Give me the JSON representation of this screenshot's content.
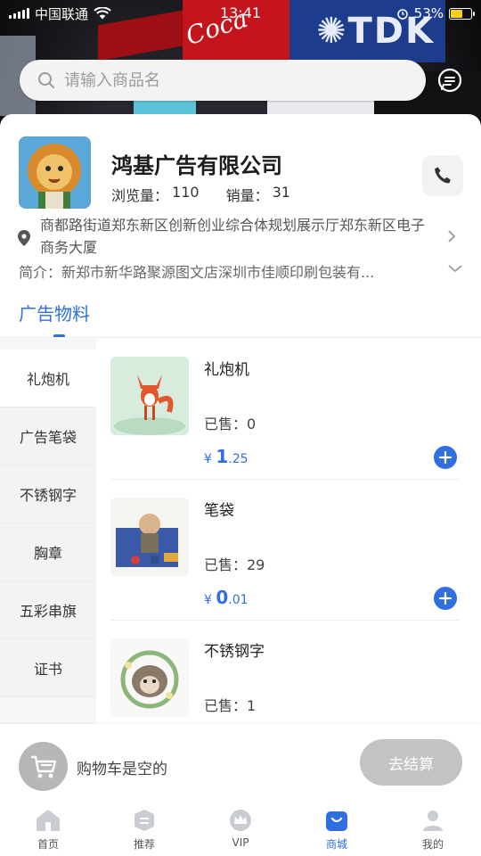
{
  "status_bar": {
    "carrier": "中国联通",
    "time": "13:41",
    "battery": "53%"
  },
  "search": {
    "placeholder": "请输入商品名"
  },
  "shop": {
    "name": "鸿基广告有限公司",
    "views_label": "浏览量：",
    "views": "110",
    "sales_label": "销量：",
    "sales": "31",
    "address": "商都路街道郑东新区创新创业综合体规划展示厅郑东新区电子商务大厦",
    "intro": "简介：新郑市新华路聚源图文店深圳市佳顺印刷包装有..."
  },
  "tab": {
    "label": "广告物料"
  },
  "categories": [
    {
      "label": "礼炮机"
    },
    {
      "label": "广告笔袋"
    },
    {
      "label": "不锈钢字"
    },
    {
      "label": "胸章"
    },
    {
      "label": "五彩串旗"
    },
    {
      "label": "证书"
    }
  ],
  "products": [
    {
      "name": "礼炮机",
      "sold": "已售：0",
      "currency": "¥",
      "price_int": "1",
      "price_dec": ".25"
    },
    {
      "name": "笔袋",
      "sold": "已售：29",
      "currency": "¥",
      "price_int": "0",
      "price_dec": ".01"
    },
    {
      "name": "不锈钢字",
      "sold": "已售：1",
      "currency": "¥",
      "price_int": "",
      "price_dec": ""
    }
  ],
  "cart": {
    "empty_text": "购物车是空的",
    "checkout_label": "去结算"
  },
  "nav": [
    {
      "label": "首页"
    },
    {
      "label": "推荐"
    },
    {
      "label": "VIP"
    },
    {
      "label": "商城"
    },
    {
      "label": "我的"
    }
  ],
  "colors": {
    "accent": "#2f6fe0",
    "cart_disabled": "#c3c3c3"
  }
}
